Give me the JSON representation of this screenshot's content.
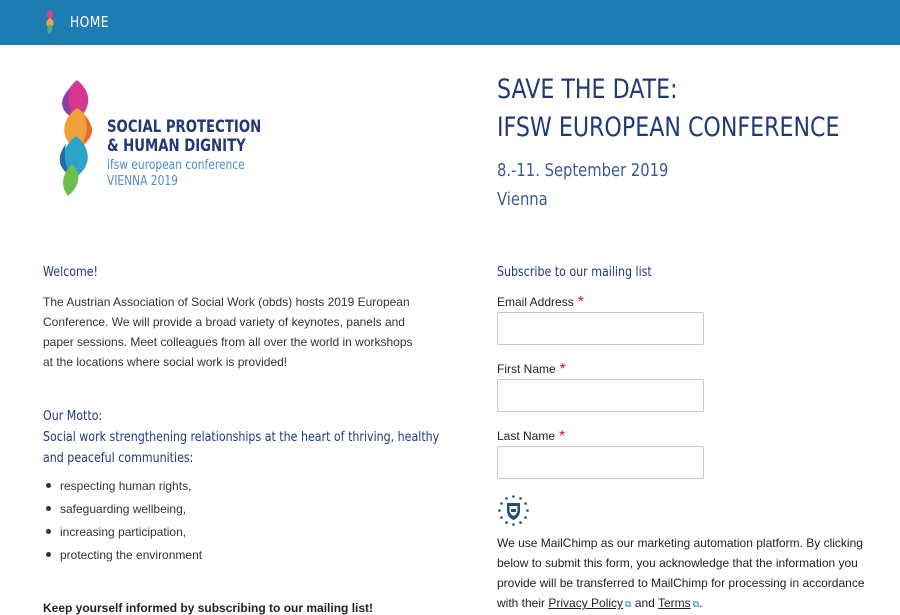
{
  "nav": {
    "home_label": "HOME"
  },
  "brand": {
    "title_line1": "SOCIAL PROTECTION",
    "title_line2": "& HUMAN DIGNITY",
    "subtitle_line1": "ifsw european conference",
    "subtitle_line2": "VIENNA 2019"
  },
  "hero": {
    "line1": "SAVE THE DATE:",
    "line2": "IFSW EUROPEAN CONFERENCE",
    "date": "8.-11. September 2019",
    "city": "Vienna"
  },
  "welcome": {
    "title": "Welcome!",
    "text": "The Austrian Association of Social Work (obds) hosts 2019 European Conference. We will provide a broad variety of keynotes, panels and paper sessions. Meet colleagues from all over the world in workshops at the locations where social work is provided!"
  },
  "motto": {
    "label": "Our Motto:",
    "line1": "Social work strengthening relationships at the heart of thriving, healthy",
    "line2": "and peaceful communities:"
  },
  "bullets": [
    "respecting human rights,",
    "safeguarding wellbeing,",
    "increasing participation,",
    "protecting the environment"
  ],
  "keep_informed": "Keep yourself informed by subscribing to our mailing list!",
  "form": {
    "title": "Subscribe to our mailing list",
    "email_label": "Email Address",
    "email_value": "",
    "first_name_label": "First Name",
    "first_name_value": "",
    "last_name_label": "Last Name",
    "last_name_value": "",
    "required_marker": "*"
  },
  "mailchimp": {
    "text_before": "We use MailChimp as our marketing automation platform. By clicking below to submit this form, you acknowledge that the information you provide will be transferred to MailChimp for processing in accordance with their ",
    "privacy_link": "Privacy Policy",
    "and": " and ",
    "terms_link": "Terms",
    "text_after": "."
  },
  "colors": {
    "topbar": "#1e7cb2",
    "heading": "#213a73",
    "required": "#cc1f1f"
  }
}
